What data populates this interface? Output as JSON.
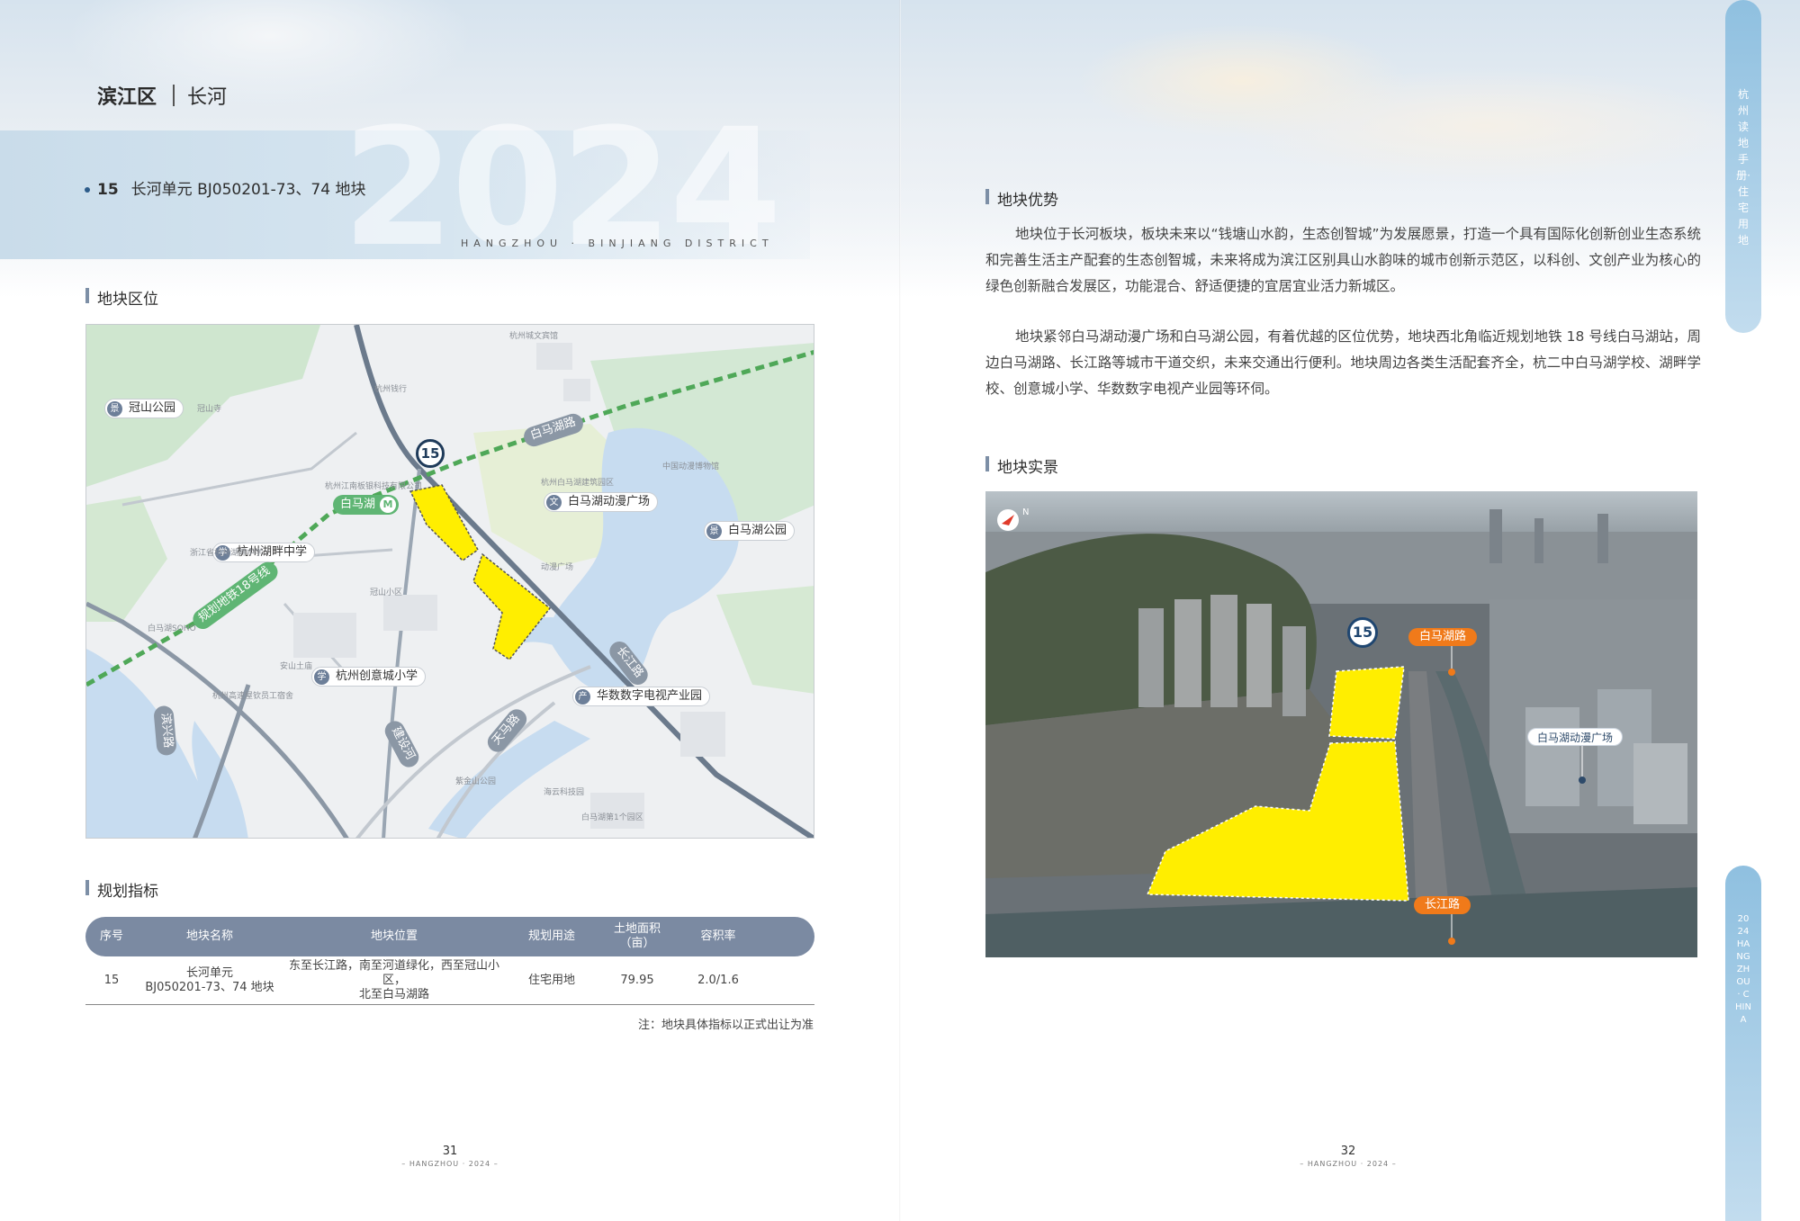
{
  "header": {
    "district": "滨江区",
    "area": "长河",
    "year_watermark": "2024",
    "district_en": "HANGZHOU · BINJIANG DISTRICT"
  },
  "plot": {
    "number": "15",
    "name": "长河单元 BJ050201-73、74 地块"
  },
  "sections": {
    "location": "地块区位",
    "indicators": "规划指标",
    "advantage": "地块优势",
    "photo": "地块实景"
  },
  "map": {
    "pin": "15",
    "labels": {
      "guanshan": "冠山公园",
      "baimahu_station": "白马湖",
      "huxuan": "杭州湖畔中学",
      "dongman": "白马湖动漫广场",
      "park": "白马湖公园",
      "chuangyi": "杭州创意城小学",
      "huashu": "华数数字电视产业园",
      "road_baimahu": "白马湖路",
      "metro18": "规划地铁18号线",
      "road_changjiang": "长江路",
      "road_binxing": "滨兴路",
      "road_jianshe": "建设河",
      "road_tian": "天马路"
    },
    "minor": [
      "冠山寺",
      "杭州江南板银科技有限公司",
      "杭州钱行",
      "中国动漫博物馆",
      "杭州白马湖建筑园区",
      "动漫广场",
      "浙江省杭州湖畔中学",
      "白马湖SOHO",
      "冠山小区",
      "安山土庙",
      "杭州高速屋钦员工宿舍",
      "海云科技园",
      "紫金山公园",
      "白马湖第1个园区",
      "杭州城文宾馆",
      "白马湖"
    ]
  },
  "table": {
    "headers": [
      "序号",
      "地块名称",
      "地块位置",
      "规划用途",
      "土地面积\n（亩）",
      "容积率"
    ],
    "rows": [
      {
        "no": "15",
        "name_1": "长河单元",
        "name_2": "BJ050201-73、74 地块",
        "loc_1": "东至长江路，南至河道绿化，西至冠山小区，",
        "loc_2": "北至白马湖路",
        "use": "住宅用地",
        "area": "79.95",
        "far": "2.0/1.6"
      }
    ],
    "note": "注：地块具体指标以正式出让为准"
  },
  "advantage": {
    "p1": "地块位于长河板块，板块未来以“钱塘山水韵，生态创智城”为发展愿景，打造一个具有国际化创新创业生态系统和完善生活主产配套的生态创智城，未来将成为滨江区别具山水韵味的城市创新示范区，以科创、文创产业为核心的绿色创新融合发展区，功能混合、舒适便捷的宜居宜业活力新城区。",
    "p2": "地块紧邻白马湖动漫广场和白马湖公园，有着优越的区位优势，地块西北角临近规划地铁 18 号线白马湖站，周边白马湖路、长江路等城市干道交织，未来交通出行便利。地块周边各类生活配套齐全，杭二中白马湖学校、湖畔学校、创意城小学、华数数字电视产业园等环伺。"
  },
  "photo": {
    "pin": "15",
    "tag_top": "白马湖路",
    "tag_bottom": "长江路",
    "tag_place": "白马湖动漫广场",
    "north": "N"
  },
  "pages": {
    "left": "31",
    "right": "32",
    "footer": "– HANGZHOU · 2024 –"
  },
  "side": {
    "top_text": "杭州读地手册·住宅用地",
    "bottom_text": "2024 HANGZHOU · CHINA"
  },
  "colors": {
    "accent": "#7b8aa2",
    "plot_fill": "#ffee00",
    "tag_orange": "#f07a1a"
  }
}
